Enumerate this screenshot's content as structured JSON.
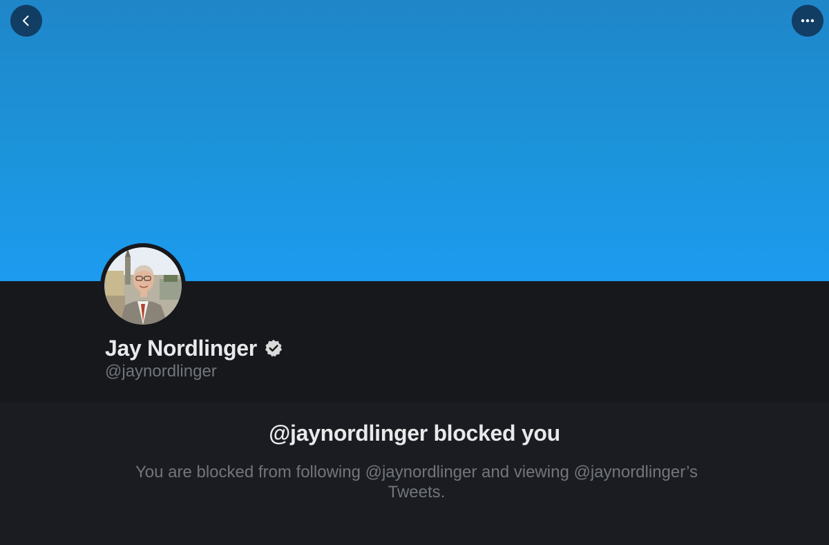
{
  "header": {
    "back_icon": "chevron-left-icon",
    "more_icon": "more-horizontal-icon",
    "banner_color": "#1d9bf0"
  },
  "profile": {
    "display_name": "Jay Nordlinger",
    "verified_icon": "verified-badge-icon",
    "handle": "@jaynordlinger"
  },
  "blocked": {
    "title": "@jaynordlinger blocked you",
    "description": "You are blocked from following @jaynordlinger and viewing @jaynordlinger’s Tweets."
  }
}
